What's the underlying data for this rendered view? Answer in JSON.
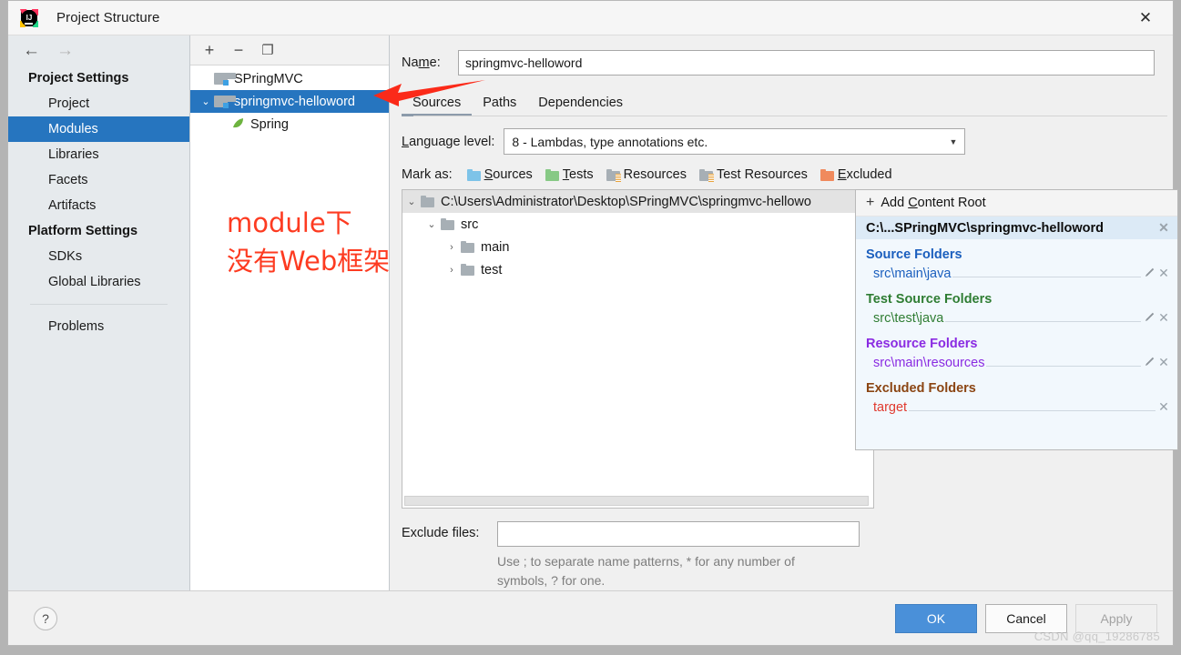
{
  "window": {
    "title": "Project Structure",
    "app_icon": "intellij-idea-logo",
    "close_label": "✕"
  },
  "sidebar": {
    "back_icon": "←",
    "forward_icon": "→",
    "groups": [
      {
        "label": "Project Settings",
        "items": [
          {
            "label": "Project",
            "selected": false
          },
          {
            "label": "Modules",
            "selected": true
          },
          {
            "label": "Libraries",
            "selected": false
          },
          {
            "label": "Facets",
            "selected": false
          },
          {
            "label": "Artifacts",
            "selected": false
          }
        ]
      },
      {
        "label": "Platform Settings",
        "items": [
          {
            "label": "SDKs",
            "selected": false
          },
          {
            "label": "Global Libraries",
            "selected": false
          }
        ]
      }
    ],
    "problems_label": "Problems"
  },
  "module_panel": {
    "toolbar": {
      "add_label": "+",
      "remove_label": "−",
      "copy_label": "❐"
    },
    "tree": [
      {
        "label": "SPringMVC",
        "kind": "module",
        "indent": 1,
        "chevron": "",
        "selected": false
      },
      {
        "label": "springmvc-helloword",
        "kind": "module",
        "indent": 0,
        "chevron": "⌄",
        "selected": true
      },
      {
        "label": "Spring",
        "kind": "facet",
        "indent": 2,
        "chevron": "",
        "selected": false
      }
    ],
    "annotation": "module下\n没有Web框架"
  },
  "main": {
    "name_label": "Name:",
    "name_value": "springmvc-helloword",
    "tabs": [
      {
        "label": "Sources",
        "active": true
      },
      {
        "label": "Paths",
        "active": false
      },
      {
        "label": "Dependencies",
        "active": false
      }
    ],
    "language_level": {
      "label": "Language level:",
      "value": "8 - Lambdas, type annotations etc.",
      "arrow_icon": "▼"
    },
    "mark_as": {
      "label": "Mark as:",
      "options": [
        {
          "label": "Sources",
          "color": "#7dc3e8",
          "icon": "folder-blue-icon"
        },
        {
          "label": "Tests",
          "color": "#87c985",
          "icon": "folder-green-icon"
        },
        {
          "label": "Resources",
          "color": "#a7afb5",
          "icon": "folder-resources-icon"
        },
        {
          "label": "Test Resources",
          "color": "#a7afb5",
          "icon": "folder-test-resources-icon"
        },
        {
          "label": "Excluded",
          "color": "#f08a5d",
          "icon": "folder-orange-icon"
        }
      ]
    },
    "content_tree": [
      {
        "label": "C:\\Users\\Administrator\\Desktop\\SPringMVC\\springmvc-hellowo",
        "indent": 0,
        "chevron": "⌄",
        "root": true
      },
      {
        "label": "src",
        "indent": 1,
        "chevron": "⌄",
        "root": false
      },
      {
        "label": "main",
        "indent": 2,
        "chevron": "›",
        "root": false
      },
      {
        "label": "test",
        "indent": 2,
        "chevron": "›",
        "root": false
      }
    ],
    "exclude": {
      "label": "Exclude files:",
      "value": "",
      "hint_line1": "Use ; to separate name patterns, * for any number of",
      "hint_line2": "symbols, ? for one."
    }
  },
  "root_panel": {
    "add_content_root": "Add Content Root",
    "plus_icon": "+",
    "root_path": "C:\\...SPringMVC\\springmvc-helloword",
    "close_icon": "✕",
    "pencil_icon": "✎",
    "groups": [
      {
        "title": "Source Folders",
        "color": "#1b5fbe",
        "entries": [
          {
            "path": "src\\main\\java",
            "editable": true
          }
        ]
      },
      {
        "title": "Test Source Folders",
        "color": "#2f7d33",
        "entries": [
          {
            "path": "src\\test\\java",
            "editable": true
          }
        ]
      },
      {
        "title": "Resource Folders",
        "color": "#8a2be2",
        "entries": [
          {
            "path": "src\\main\\resources",
            "editable": true
          }
        ]
      },
      {
        "title": "Excluded Folders",
        "color": "#8b4513",
        "entries": [
          {
            "path": "target",
            "editable": false
          }
        ]
      }
    ]
  },
  "footer": {
    "help_label": "?",
    "ok_label": "OK",
    "cancel_label": "Cancel",
    "apply_label": "Apply"
  },
  "watermark": "CSDN @qq_19286785"
}
